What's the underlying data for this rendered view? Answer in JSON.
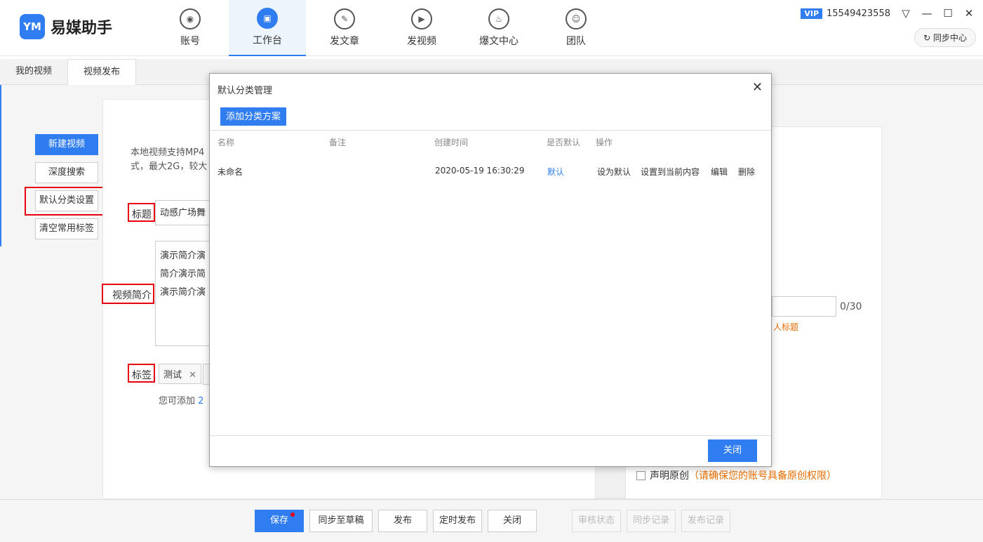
{
  "app": {
    "logo_mark": "YM",
    "name": "易媒助手"
  },
  "nav": [
    {
      "label": "账号",
      "icon": "account-icon",
      "glyph": "◉"
    },
    {
      "label": "工作台",
      "icon": "workbench-icon",
      "glyph": "▣"
    },
    {
      "label": "发文章",
      "icon": "article-icon",
      "glyph": "✎"
    },
    {
      "label": "发视频",
      "icon": "video-icon",
      "glyph": "▶"
    },
    {
      "label": "爆文中心",
      "icon": "fire-icon",
      "glyph": "♨"
    },
    {
      "label": "团队",
      "icon": "team-icon",
      "glyph": "☺"
    }
  ],
  "topright": {
    "vip": "VIP",
    "phone": "15549423558",
    "menu": "▽",
    "minimize": "—",
    "maximize": "☐",
    "close": "✕",
    "sync_center": "同步中心",
    "sync_icon": "↻"
  },
  "subtabs": [
    "我的视频",
    "视频发布"
  ],
  "sidebar": {
    "new_video": "新建视频",
    "deep_search": "深度搜索",
    "default_category": "默认分类设置",
    "clear_tags": "清空常用标签"
  },
  "form": {
    "upload_tip_1": "本地视频支持MP4",
    "upload_tip_2": "式，最大2G，较大",
    "title_label": "标题",
    "title_value": "动感广场舞",
    "intro_label": "视频简介",
    "intro_lines": [
      "演示简介演",
      "简介演示简",
      "演示简介演"
    ],
    "tags_label": "标签",
    "tag_1": "测试",
    "tag_remove": "✕",
    "tags_tip_prefix": "您可添加 ",
    "tags_tip_num": "2"
  },
  "right": {
    "counter": "0/30",
    "hint": "人标题",
    "declare_original": "声明原创",
    "declare_warning": "（请确保您的账号具备原创权限）"
  },
  "bottom": {
    "save": "保存",
    "sync_draft": "同步至草稿",
    "publish": "发布",
    "schedule": "定时发布",
    "close": "关闭",
    "review_status": "审核状态",
    "sync_records": "同步记录",
    "publish_records": "发布记录"
  },
  "modal": {
    "title": "默认分类管理",
    "close": "✕",
    "add_button": "添加分类方案",
    "columns": [
      "名称",
      "备注",
      "创建时间",
      "是否默认",
      "操作"
    ],
    "row": {
      "name": "未命名",
      "note": "",
      "created": "2020-05-19 16:30:29",
      "is_default": "默认",
      "actions": [
        "设为默认",
        "设置到当前内容",
        "编辑",
        "删除"
      ]
    },
    "ok": "关闭"
  },
  "colors": {
    "accent": "#2f7df0",
    "highlight": "#e60012",
    "warning": "#e66c00"
  }
}
